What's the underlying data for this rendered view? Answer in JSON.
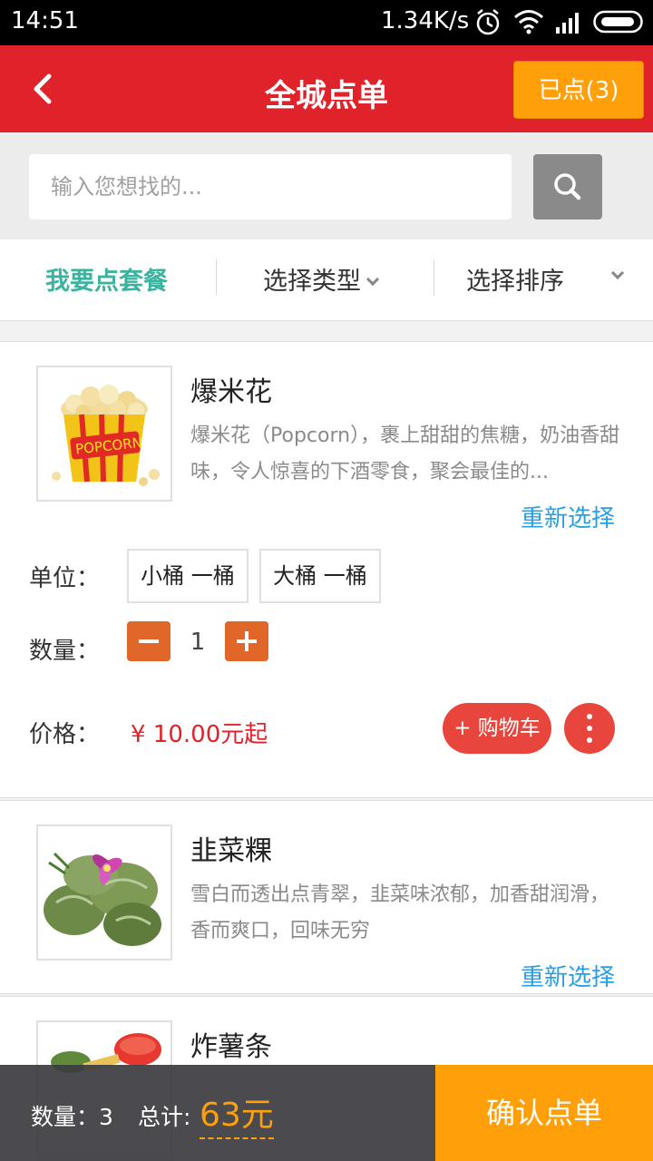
{
  "status_bar": {
    "time": "14:51",
    "speed": "1.34K/s"
  },
  "header": {
    "title": "全城点单",
    "ordered_button": "已点(3)"
  },
  "search": {
    "placeholder": "输入您想找的..."
  },
  "filters": {
    "combo": "我要点套餐",
    "type": "选择类型",
    "sort": "选择排序"
  },
  "items": [
    {
      "name": "爆米花",
      "description": "爆米花（Popcorn），裹上甜甜的焦糖，奶油香甜味，令人惊喜的下酒零食，聚会最佳的...",
      "reselect": "重新选择",
      "unit_label": "单位：",
      "units": [
        "小桶 一桶",
        "大桶 一桶"
      ],
      "qty_label": "数量：",
      "quantity": "1",
      "price_label": "价格：",
      "price": "¥ 10.00元起",
      "cart_button": "+ 购物车"
    },
    {
      "name": "韭菜粿",
      "description": "雪白而透出点青翠，韭菜味浓郁，加香甜润滑，香而爽口，回味无穷",
      "reselect": "重新选择"
    },
    {
      "name": "炸薯条"
    }
  ],
  "bottom": {
    "qty_text": "数量：3",
    "total_label": "总计:",
    "total": "63元",
    "confirm": "确认点单"
  },
  "colors": {
    "header": "#e0222b",
    "accent_orange": "#ff9f0a",
    "active_filter": "#3cb39e",
    "link_blue": "#2a9ee0",
    "qty_button": "#e1662a",
    "cart_red": "#e8463d"
  }
}
